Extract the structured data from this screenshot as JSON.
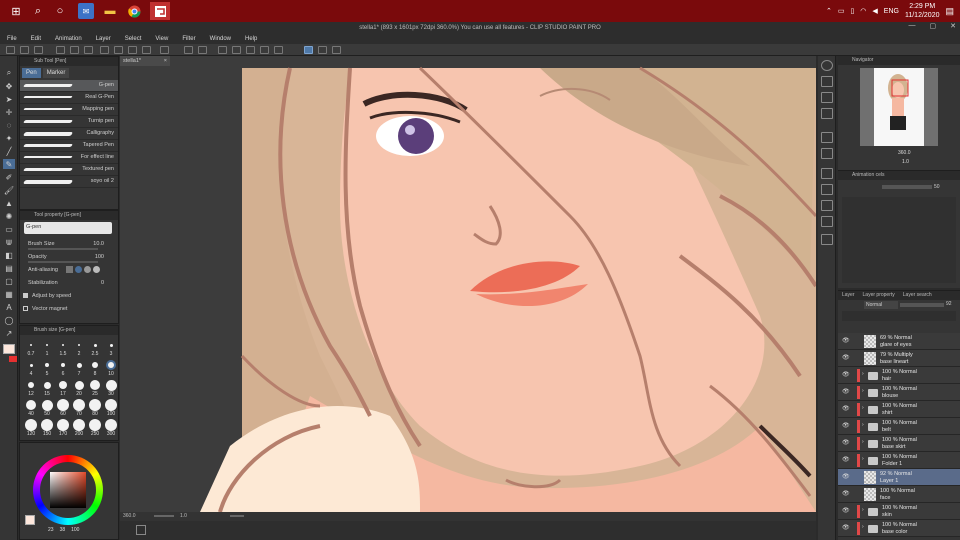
{
  "taskbar": {
    "icons": [
      "windows-icon",
      "search-icon",
      "cortana-icon",
      "mail-icon",
      "folder-icon",
      "chrome-icon",
      "clip-studio-icon"
    ],
    "language": "ENG",
    "time": "2:29 PM",
    "date": "11/12/2020"
  },
  "window": {
    "title": "stella1* (893 x 1601px 72dpi 360.0%)  You can use all features - CLIP STUDIO PAINT PRO",
    "controls": [
      "minimize",
      "maximize",
      "close"
    ]
  },
  "menu": [
    "File",
    "Edit",
    "Animation",
    "Layer",
    "Select",
    "View",
    "Filter",
    "Window",
    "Help"
  ],
  "subtool": {
    "header": "Sub Tool [Pen]",
    "tabs": [
      "Pen",
      "Marker"
    ],
    "brushes": [
      "G-pen",
      "Real G-Pen",
      "Mapping pen",
      "Turnip pen",
      "Calligraphy",
      "Tapered Pen",
      "For effect line",
      "Textured pen",
      "soyo oil 2"
    ]
  },
  "toolprop": {
    "header": "Tool property [G-pen]",
    "preset": "G-pen",
    "brush_size_label": "Brush Size",
    "brush_size": "10.0",
    "opacity_label": "Opacity",
    "opacity": "100",
    "aa_label": "Anti-aliasing",
    "stab_label": "Stabilization",
    "stab_value": "0",
    "adjust_label": "Adjust by speed",
    "vector_label": "Vector magnet"
  },
  "brushsize": {
    "header": "Brush size [G-pen]",
    "labels": [
      "0.7",
      "1",
      "1.5",
      "2",
      "2.5",
      "3",
      "4",
      "5",
      "6",
      "7",
      "8",
      "10",
      "12",
      "15",
      "17",
      "20",
      "25",
      "30",
      "40",
      "50",
      "60",
      "70",
      "80",
      "100",
      "120",
      "150",
      "170",
      "200",
      "250",
      "300"
    ]
  },
  "color": {
    "values": [
      "23",
      "38",
      "100"
    ]
  },
  "canvas": {
    "tab": "stella1*",
    "zoom": "360.0",
    "angle": "1.0",
    "colors": {
      "hair": "#d2b391",
      "skin": "#f9c7b0",
      "lineart": "#b67f6c",
      "lip": "#ec6d57",
      "bg": "#3c3c3c"
    }
  },
  "navigator": {
    "header": "Navigator",
    "zoom": "360.0",
    "angle": "1.0"
  },
  "animation": {
    "header": "Animation cels",
    "opacity": "50"
  },
  "layers": {
    "tabs": [
      "Layer",
      "Layer property",
      "Layer search"
    ],
    "blend_mode": "Normal",
    "opacity": "92",
    "rows": [
      {
        "line1": "69 % Normal",
        "line2": "glare of eyes",
        "kind": "layer"
      },
      {
        "line1": "79 % Multiply",
        "line2": "base lineart",
        "kind": "layer"
      },
      {
        "line1": "100 % Normal",
        "line2": "hair",
        "kind": "folder"
      },
      {
        "line1": "100 % Normal",
        "line2": "blouse",
        "kind": "folder"
      },
      {
        "line1": "100 % Normal",
        "line2": "shirt",
        "kind": "folder"
      },
      {
        "line1": "100 % Normal",
        "line2": "belt",
        "kind": "folder"
      },
      {
        "line1": "100 % Normal",
        "line2": "base skirt",
        "kind": "folder"
      },
      {
        "line1": "100 % Normal",
        "line2": "Folder 1",
        "kind": "folder"
      },
      {
        "line1": "92 % Normal",
        "line2": "Layer 1",
        "kind": "layer",
        "selected": true
      },
      {
        "line1": "100 % Normal",
        "line2": "face",
        "kind": "layer"
      },
      {
        "line1": "100 % Normal",
        "line2": "skin",
        "kind": "folder"
      },
      {
        "line1": "100 % Normal",
        "line2": "base color",
        "kind": "folder"
      }
    ]
  }
}
